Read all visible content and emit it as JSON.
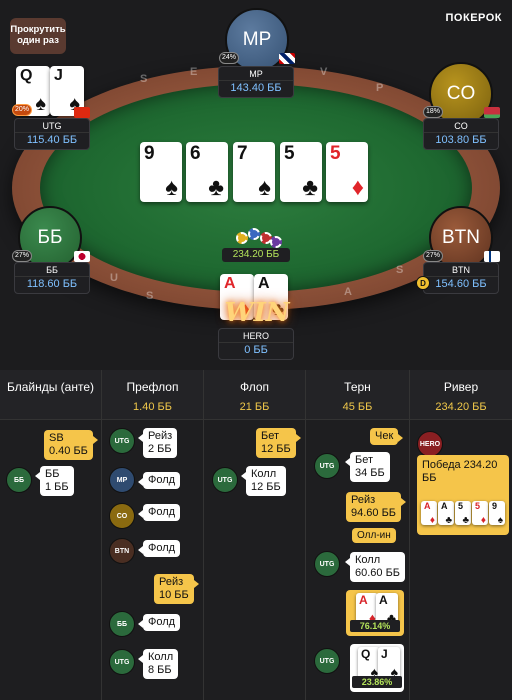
{
  "top_button": "Прокрутить один раз",
  "brand": "ПОКЕРОК",
  "rim_letters": [
    "S",
    "E",
    "V",
    "P",
    "U",
    "S",
    "A",
    "S",
    "U",
    "S"
  ],
  "board": [
    {
      "rank": "9",
      "suit": "♠",
      "red": false
    },
    {
      "rank": "6",
      "suit": "♣",
      "red": false
    },
    {
      "rank": "7",
      "suit": "♠",
      "red": false
    },
    {
      "rank": "5",
      "suit": "♣",
      "red": false
    },
    {
      "rank": "5",
      "suit": "♦",
      "red": true
    }
  ],
  "pot": "234.20 ББ",
  "win_text": "WIN",
  "seats": {
    "mp": {
      "avatar": "MP",
      "name": "MP",
      "stack": "143.40 ББ",
      "pct": "24%"
    },
    "utg": {
      "name": "UTG",
      "stack": "115.40 ББ",
      "pct": "20%",
      "cards": [
        {
          "rank": "Q",
          "suit": "♠"
        },
        {
          "rank": "J",
          "suit": "♠"
        }
      ]
    },
    "co": {
      "avatar": "CO",
      "name": "CO",
      "stack": "103.80 ББ",
      "pct": "18%"
    },
    "bb": {
      "avatar": "ББ",
      "name": "ББ",
      "stack": "118.60 ББ",
      "pct": "27%"
    },
    "btn": {
      "avatar": "BTN",
      "name": "BTN",
      "stack": "154.60 ББ",
      "pct": "27%",
      "dealer": "D"
    },
    "hero": {
      "name": "HERO",
      "stack": "0 ББ",
      "cards": [
        {
          "rank": "A",
          "suit": "♦"
        },
        {
          "rank": "A",
          "suit": "♣"
        }
      ]
    }
  },
  "history": {
    "columns": [
      {
        "title": "Блайнды (анте)",
        "value": ""
      },
      {
        "title": "Префлоп",
        "value": "1.40 ББ"
      },
      {
        "title": "Флоп",
        "value": "21 ББ"
      },
      {
        "title": "Терн",
        "value": "45 ББ"
      },
      {
        "title": "Ривер",
        "value": "234.20 ББ"
      }
    ],
    "blinds": {
      "sb": "SB\n0.40 ББ",
      "bb_pos": "ББ",
      "bb": "ББ\n1 ББ"
    },
    "preflop": [
      {
        "pos": "UTG",
        "text": "Рейз\n2 ББ"
      },
      {
        "pos": "MP",
        "text": "Фолд"
      },
      {
        "pos": "CO",
        "text": "Фолд"
      },
      {
        "pos": "BTN",
        "text": "Фолд"
      },
      {
        "pos": "",
        "text": "Рейз\n10 ББ"
      },
      {
        "pos": "ББ",
        "text": "Фолд"
      },
      {
        "pos": "UTG",
        "text": "Колл\n8 ББ"
      }
    ],
    "flop": [
      {
        "pos": "",
        "text": "Бет\n12 ББ"
      },
      {
        "pos": "UTG",
        "text": "Колл\n12 ББ"
      }
    ],
    "turn": [
      {
        "pos": "",
        "text": "Чек"
      },
      {
        "pos": "UTG",
        "text": "Бет\n34 ББ"
      },
      {
        "pos": "",
        "text": "Рейз\n94.60 ББ"
      },
      {
        "pos": "",
        "text": "Олл-ин"
      },
      {
        "pos": "UTG",
        "text": "Колл\n60.60 ББ"
      },
      {
        "pos": "",
        "text": "76.14%"
      },
      {
        "pos": "UTG",
        "text": "23.86%"
      }
    ],
    "river": {
      "pos": "HERO",
      "text": "Победа 234.20 ББ"
    }
  }
}
